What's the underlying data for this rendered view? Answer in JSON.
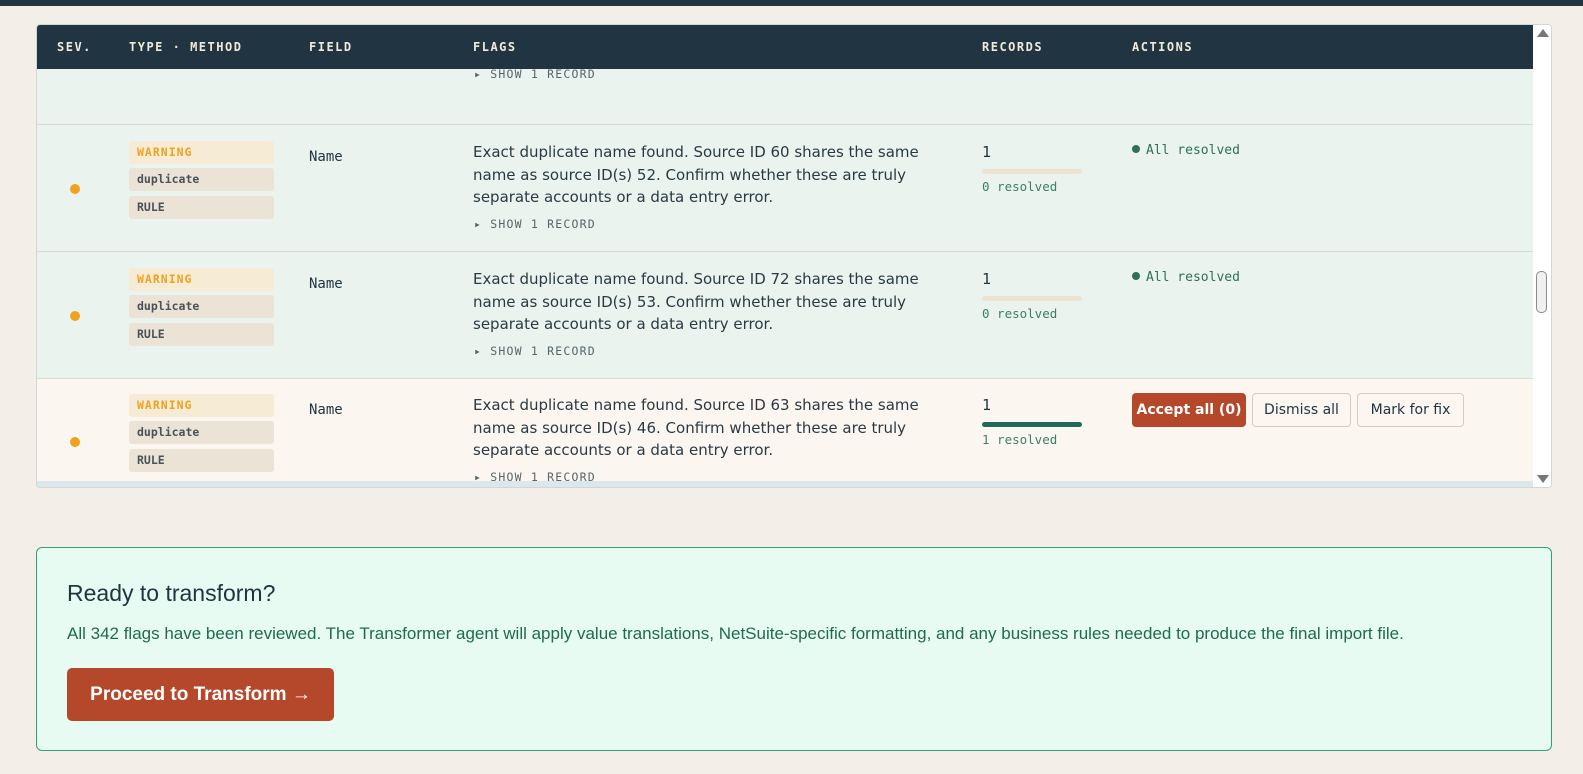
{
  "table": {
    "headers": {
      "sev": "SEV.",
      "type_method": "TYPE · METHOD",
      "field": "FIELD",
      "flags": "FLAGS",
      "records": "RECORDS",
      "actions": "ACTIONS"
    },
    "partial_row": {
      "show_records": "▸ SHOW 1 RECORD"
    },
    "rows": [
      {
        "severity": "WARNING",
        "type": "duplicate",
        "method": "RULE",
        "field": "Name",
        "flag_text": "Exact duplicate name found. Source ID 60 shares the same name as source ID(s) 52. Confirm whether these are truly separate accounts or a data entry error.",
        "show_records": "▸ SHOW 1 RECORD",
        "record_count": "1",
        "resolved_label": "0 resolved",
        "resolved_fraction": 0,
        "action_status": "All resolved"
      },
      {
        "severity": "WARNING",
        "type": "duplicate",
        "method": "RULE",
        "field": "Name",
        "flag_text": "Exact duplicate name found. Source ID 72 shares the same name as source ID(s) 53. Confirm whether these are truly separate accounts or a data entry error.",
        "show_records": "▸ SHOW 1 RECORD",
        "record_count": "1",
        "resolved_label": "0 resolved",
        "resolved_fraction": 0,
        "action_status": "All resolved"
      },
      {
        "severity": "WARNING",
        "type": "duplicate",
        "method": "RULE",
        "field": "Name",
        "flag_text": "Exact duplicate name found. Source ID 63 shares the same name as source ID(s) 46. Confirm whether these are truly separate accounts or a data entry error.",
        "show_records": "▸ SHOW 1 RECORD",
        "record_count": "1",
        "resolved_label": "1 resolved",
        "resolved_fraction": 1,
        "actions": {
          "accept_all": "Accept all (0)",
          "dismiss_all": "Dismiss all",
          "mark_for_fix": "Mark for fix"
        }
      }
    ]
  },
  "cta": {
    "title": "Ready to transform?",
    "description": "All 342 flags have been reviewed. The Transformer agent will apply value translations, NetSuite-specific formatting, and any business rules needed to produce the final import file.",
    "button": "Proceed to Transform →"
  },
  "colors": {
    "header_bg": "#203541",
    "warning": "#f0a21e",
    "resolved_row_bg": "#eaf3ee",
    "pending_row_bg": "#fbf7f0",
    "accent_red": "#b5482b",
    "success_green": "#1f6b57",
    "cta_bg": "#e8fbf2",
    "cta_border": "#2ea07a"
  }
}
